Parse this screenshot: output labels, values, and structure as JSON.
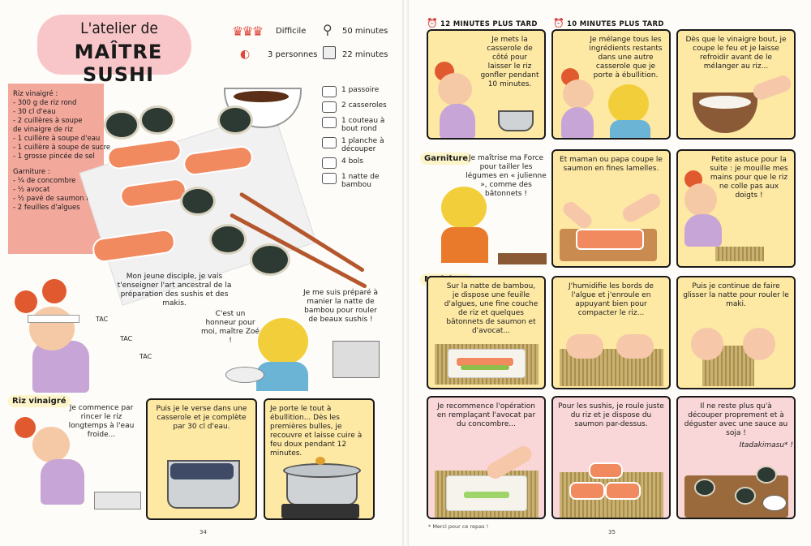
{
  "left_page": {
    "title_line1": "L'atelier de",
    "title_line2": "MAÎTRE SUSHI",
    "meta": {
      "difficulty": "Difficile",
      "time_total": "50 minutes",
      "servings": "3 personnes",
      "time_active": "22 minutes"
    },
    "ingredients": [
      "Riz vinaigré :",
      "- 300 g de riz rond",
      "- 30 cl d'eau",
      "- 2 cuillères à soupe",
      "  de vinaigre de riz",
      "- 1 cuillère à soupe d'eau",
      "- 1 cuillère à soupe de sucre",
      "- 1 grosse pincée de sel",
      "",
      "Garniture :",
      "- ¼ de concombre",
      "- ½ avocat",
      "- ½ pavé de saumon frais",
      "- 2 feuilles d'algues"
    ],
    "tools": [
      {
        "icon": "strainer-icon",
        "label": "1 passoire"
      },
      {
        "icon": "saucepan-icon",
        "label": "2 casseroles"
      },
      {
        "icon": "knife-icon",
        "label": "1 couteau à bout rond"
      },
      {
        "icon": "cutting-board-icon",
        "label": "1 planche à découper"
      },
      {
        "icon": "bowl-icon",
        "label": "4 bols"
      },
      {
        "icon": "bamboo-mat-icon",
        "label": "1 natte de bambou"
      }
    ],
    "intro": {
      "master_speech": "Mon jeune disciple, je vais t'enseigner l'art ancestral de la préparation des sushis et des makis.",
      "student_speech1": "C'est un honneur pour moi, maître Zoé !",
      "student_speech2": "Je me suis préparé à manier la natte de bambou pour rouler de beaux sushis !",
      "sfx1": "TAC",
      "sfx2": "TAC",
      "sfx3": "TAC"
    },
    "section_rice": "Riz vinaigré",
    "rice_panels": [
      "Je commence par rincer le riz longtemps à l'eau froide...",
      "Puis je le verse dans une casserole et je complète par 30 cl d'eau.",
      "Je porte le tout à ébullition... Dès les premières bulles, je recouvre et laisse cuire à feu doux pendant 12 minutes."
    ],
    "page_number": "34"
  },
  "right_page": {
    "caption1": "12 MINUTES PLUS TARD",
    "caption2": "10 MINUTES PLUS TARD",
    "row1": [
      "Je mets la casserole de côté pour laisser le riz gonfler pendant 10 minutes.",
      "Je mélange tous les ingrédients restants dans une autre casserole que je porte à ébullition.",
      "Dès que le vinaigre bout, je coupe le feu et je laisse refroidir avant de le mélanger au riz..."
    ],
    "section_garnish": "Garniture",
    "row2": [
      "Je maîtrise ma Force pour tailler les légumes en « julienne », comme des bâtonnets !",
      "Et maman ou papa coupe le saumon en fines lamelles.",
      "Petite astuce pour la suite : je mouille mes mains pour que le riz ne colle pas aux doigts !"
    ],
    "section_shaping": "Modelage",
    "row3": [
      "Sur la natte de bambou, je dispose une feuille d'algues, une fine couche de riz et quelques bâtonnets de saumon et d'avocat...",
      "J'humidifie les bords de l'algue et j'enroule en appuyant bien pour compacter le riz...",
      "Puis je continue de faire glisser la natte pour rouler le maki."
    ],
    "row4": [
      "Je recommence l'opération en remplaçant l'avocat par du concombre...",
      "Pour les sushis, je roule juste du riz et je dispose du saumon par-dessus.",
      "Il ne reste plus qu'à découper proprement et à déguster avec une sauce au soja !"
    ],
    "itadakimasu": "Itadakimasu* !",
    "footnote": "* Merci pour ce repas !",
    "page_number": "35"
  },
  "colors": {
    "title_pink": "#f8c6c8",
    "ingredients_pink": "#f3a89c",
    "panel_yellow": "#fde8a4",
    "panel_pink": "#f9d6d7",
    "salmon": "#f28a60",
    "chef_hair": "#e15a2f",
    "apron_purple": "#c7a5d6"
  }
}
